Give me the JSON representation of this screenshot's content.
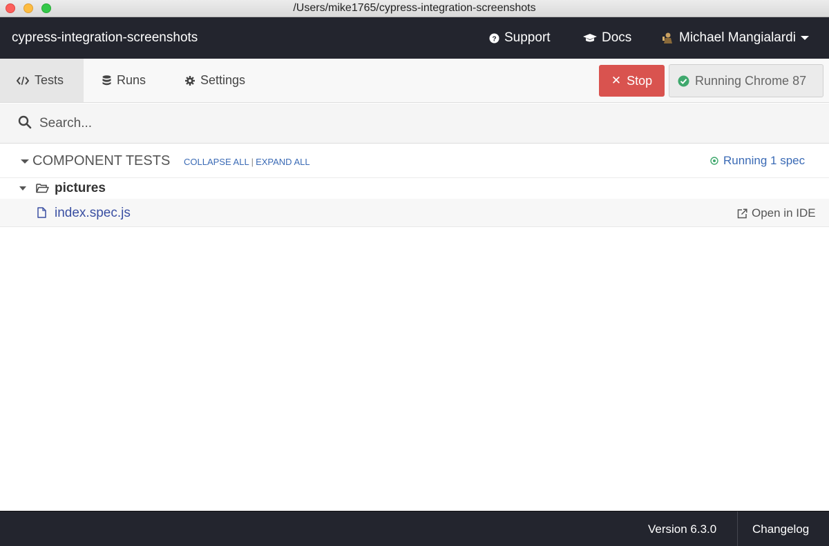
{
  "window": {
    "title": "/Users/mike1765/cypress-integration-screenshots"
  },
  "topnav": {
    "project_name": "cypress-integration-screenshots",
    "support_label": "Support",
    "docs_label": "Docs",
    "user_name": "Michael Mangialardi"
  },
  "tabs": [
    {
      "label": "Tests",
      "icon": "code-icon",
      "active": true
    },
    {
      "label": "Runs",
      "icon": "database-icon",
      "active": false
    },
    {
      "label": "Settings",
      "icon": "gear-icon",
      "active": false
    }
  ],
  "controls": {
    "stop_label": "Stop",
    "running_label": "Running Chrome 87"
  },
  "search": {
    "placeholder": "Search...",
    "value": ""
  },
  "specs": {
    "section_title": "COMPONENT TESTS",
    "collapse_all": "COLLAPSE ALL",
    "separator": "|",
    "expand_all": "EXPAND ALL",
    "running_status": "Running 1 spec",
    "folder": "pictures",
    "file": "index.spec.js",
    "open_in_ide": "Open in IDE"
  },
  "footer": {
    "version": "Version 6.3.0",
    "changelog": "Changelog"
  },
  "colors": {
    "nav_bg": "#23252e",
    "stop_red": "#d9534f",
    "running_green": "#3fa86d",
    "link_blue": "#3a6ab5"
  }
}
